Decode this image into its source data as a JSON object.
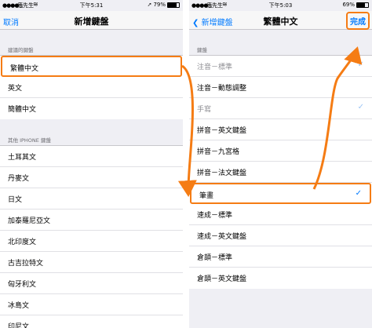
{
  "left": {
    "status": {
      "signal": "●●●●○",
      "carrier": "瘋先生",
      "time": "下午5:31",
      "battery_text": "79%",
      "battery_level": 0.79
    },
    "nav": {
      "cancel": "取消",
      "title": "新增鍵盤"
    },
    "suggested_header": "建議的鍵盤",
    "suggested": [
      "繁體中文",
      "英文",
      "簡體中文"
    ],
    "other_header": "其他 IPHONE 鍵盤",
    "other": [
      "土耳其文",
      "丹麥文",
      "日文",
      "加泰羅尼亞文",
      "北印度文",
      "古吉拉特文",
      "匈牙利文",
      "冰島文",
      "印尼文"
    ]
  },
  "right": {
    "status": {
      "signal": "●●●●○",
      "carrier": "瘋先生",
      "time": "下午5:03",
      "battery_text": "69%",
      "battery_level": 0.69
    },
    "nav": {
      "back": "新增鍵盤",
      "title": "繁體中文",
      "done": "完成"
    },
    "keyboards_header": "鍵盤",
    "keyboards": [
      {
        "label": "注音－標準",
        "checked": true,
        "dim": true
      },
      {
        "label": "注音－動態調整",
        "checked": false,
        "dim": false
      },
      {
        "label": "手寫",
        "checked": true,
        "dim": true
      },
      {
        "label": "拼音－英文鍵盤",
        "checked": false,
        "dim": false
      },
      {
        "label": "拼音－九宮格",
        "checked": false,
        "dim": false
      },
      {
        "label": "拼音－法文鍵盤",
        "checked": false,
        "dim": false
      },
      {
        "label": "筆畫",
        "checked": true,
        "dim": false
      },
      {
        "label": "速成－標準",
        "checked": false,
        "dim": false
      },
      {
        "label": "速成－英文鍵盤",
        "checked": false,
        "dim": false
      },
      {
        "label": "倉頡－標準",
        "checked": false,
        "dim": false
      },
      {
        "label": "倉頡－英文鍵盤",
        "checked": false,
        "dim": false
      }
    ]
  },
  "icons": {
    "wifi": "wifi-icon",
    "checkmark": "checkmark-icon",
    "back_chevron": "chevron-left-icon",
    "location": "location-arrow-icon"
  },
  "colors": {
    "accent": "#007aff",
    "highlight": "#f57c14",
    "background": "#efeff4"
  }
}
